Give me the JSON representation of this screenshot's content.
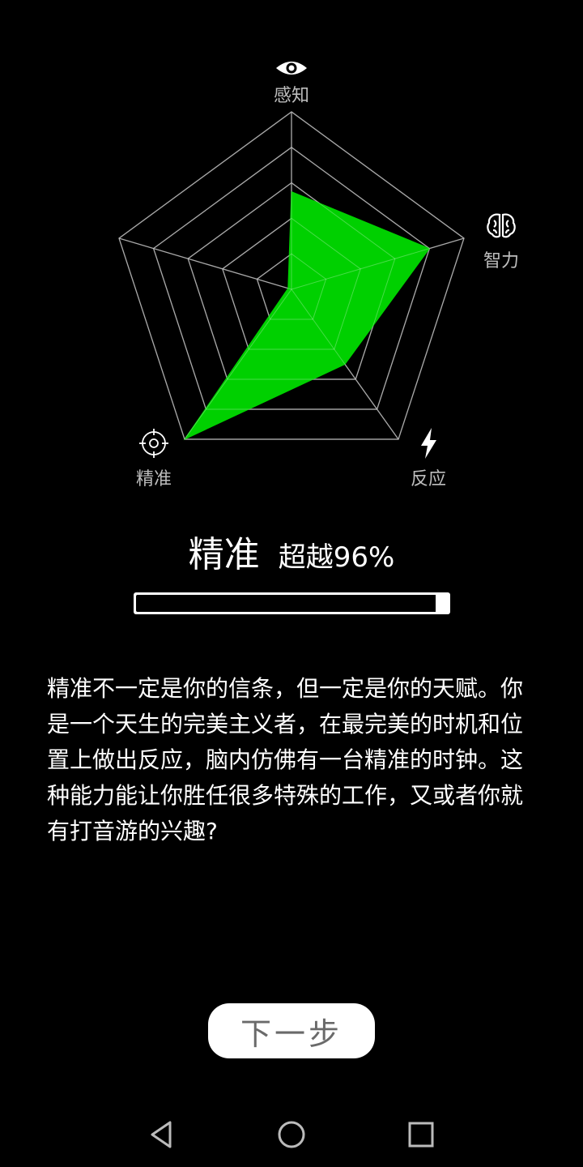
{
  "chart_data": {
    "type": "radar",
    "axes": [
      "感知",
      "智力",
      "反应",
      "精准"
    ],
    "axis_icons": [
      "eye-icon",
      "brain-icon",
      "lightning-icon",
      "target-icon"
    ],
    "values": [
      0.55,
      0.8,
      0.5,
      1.0
    ],
    "max": 1.0,
    "rings": 5,
    "fill_color": "#00d000"
  },
  "result": {
    "name": "精准",
    "exceed_text": "超越96%",
    "percent": 96
  },
  "description": "精准不一定是你的信条，但一定是你的天赋。你是一个天生的完美主义者，在最完美的时机和位置上做出反应，脑内仿佛有一台精准的时钟。这种能力能让你胜任很多特殊的工作，又或者你就有打音游的兴趣?",
  "next_button": {
    "label": "下一步"
  },
  "colors": {
    "background": "#000000",
    "grid": "#8a8a8a",
    "label": "#bdbdbd",
    "accent": "#00d000"
  }
}
